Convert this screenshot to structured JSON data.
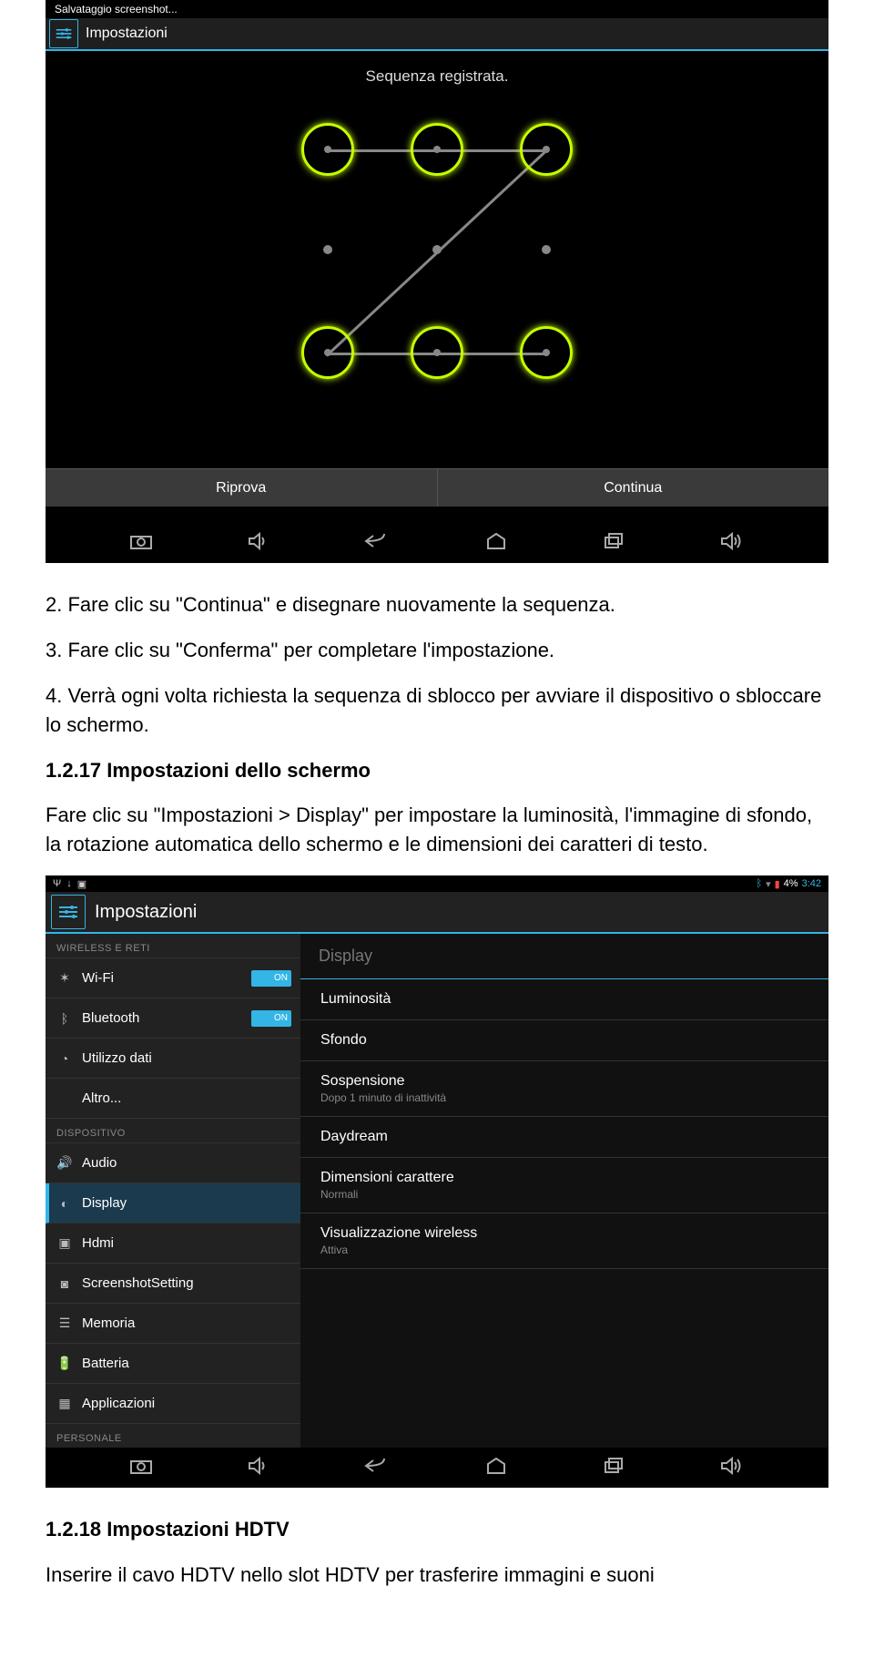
{
  "screenshot1": {
    "status_text": "Salvataggio screenshot...",
    "header_title": "Impostazioni",
    "subtitle": "Sequenza registrata.",
    "button_retry": "Riprova",
    "button_continue": "Continua"
  },
  "doc1": {
    "p1": "2. Fare clic su \"Continua\" e disegnare nuovamente la sequenza.",
    "p2": "3. Fare clic su \"Conferma\" per completare l'impostazione.",
    "p3": "4. Verrà ogni volta richiesta la sequenza di sblocco per avviare il dispositivo o sbloccare lo schermo.",
    "h1": "1.2.17 Impostazioni dello schermo",
    "p4": "Fare clic su \"Impostazioni > Display\" per impostare la luminosità, l'immagine di sfondo, la rotazione automatica dello schermo e le dimensioni dei caratteri di testo."
  },
  "screenshot2": {
    "status_time": "3:42",
    "status_battery": "4%",
    "header_title": "Impostazioni",
    "category_wireless": "WIRELESS E RETI",
    "category_device": "DISPOSITIVO",
    "category_personal": "PERSONALE",
    "toggle_on": "ON",
    "sidebar": {
      "wifi": "Wi-Fi",
      "bluetooth": "Bluetooth",
      "data": "Utilizzo dati",
      "more": "Altro...",
      "audio": "Audio",
      "display": "Display",
      "hdmi": "Hdmi",
      "screenshot": "ScreenshotSetting",
      "storage": "Memoria",
      "battery": "Batteria",
      "apps": "Applicazioni"
    },
    "main": {
      "title": "Display",
      "brightness": "Luminosità",
      "wallpaper": "Sfondo",
      "sleep": "Sospensione",
      "sleep_sub": "Dopo 1 minuto di inattività",
      "daydream": "Daydream",
      "fontsize": "Dimensioni carattere",
      "fontsize_sub": "Normali",
      "wireless_display": "Visualizzazione wireless",
      "wireless_display_sub": "Attiva"
    }
  },
  "doc2": {
    "h1": "1.2.18 Impostazioni HDTV",
    "p1": "Inserire il cavo HDTV nello slot HDTV per trasferire immagini e suoni"
  }
}
